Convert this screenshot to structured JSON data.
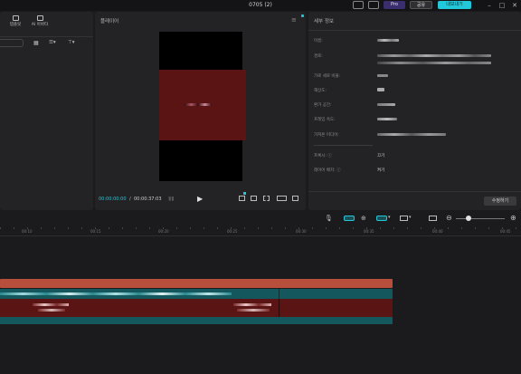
{
  "titlebar": {
    "title": "0705 (2)",
    "pro_label": "Pro",
    "share_label": "공유",
    "export_label": "내보내기"
  },
  "left_panel": {
    "tools": [
      {
        "label": "템플릿",
        "icon": "template-icon"
      },
      {
        "label": "AI 아바타",
        "icon": "avatar-icon"
      }
    ]
  },
  "player": {
    "title": "플레이어",
    "time_current": "00:00:00:00",
    "time_total": "00:00:37:03"
  },
  "details": {
    "title": "세부 정보",
    "rows": [
      {
        "label": "이름:"
      },
      {
        "label": "경로:"
      },
      {
        "label": "가로 세로 비율:"
      },
      {
        "label": "해상도:"
      },
      {
        "label": "환가 공간:"
      },
      {
        "label": "프레임 속도:"
      },
      {
        "label": "가져온 미디어:"
      }
    ],
    "proxy_label": "프록시: ⓘ",
    "proxy_value": "끄기",
    "layer_label": "레이어 배치: ⓘ",
    "layer_value": "켜기",
    "edit_button": "수정하기"
  },
  "timeline": {
    "ticks": [
      "00:10",
      "00:15",
      "00:20",
      "00:25",
      "00:30",
      "00:35",
      "00:40",
      "00:45"
    ]
  },
  "colors": {
    "accent": "#22c7d9",
    "pro": "#6f4fd8",
    "video_red": "#5a1414",
    "teal": "#1b6e74",
    "orange_clip": "#b84f3c"
  }
}
